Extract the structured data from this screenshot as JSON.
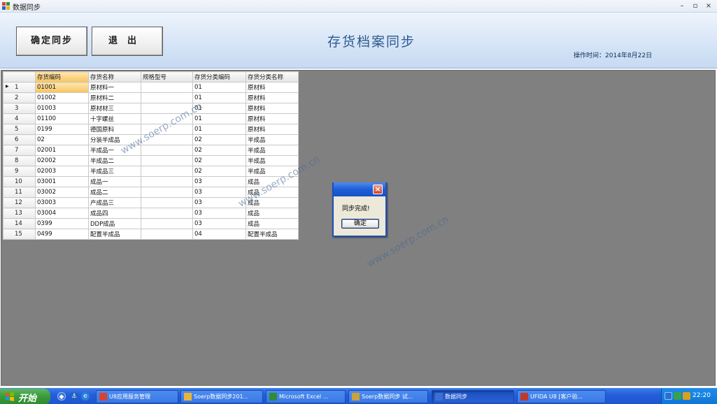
{
  "window": {
    "title": "数据同步"
  },
  "header": {
    "confirm_label": "确定同步",
    "exit_label": "退出",
    "page_title": "存货档案同步",
    "operation_time": "操作时间：2014年8月22日"
  },
  "grid": {
    "columns": [
      "存货编码",
      "存货名称",
      "规格型号",
      "存货分类编码",
      "存货分类名称"
    ],
    "rows": [
      {
        "n": "1",
        "code": "01001",
        "name": "原材料一",
        "spec": "",
        "cat_code": "01",
        "cat_name": "原材料"
      },
      {
        "n": "2",
        "code": "01002",
        "name": "原材料二",
        "spec": "",
        "cat_code": "01",
        "cat_name": "原材料"
      },
      {
        "n": "3",
        "code": "01003",
        "name": "原材材三",
        "spec": "",
        "cat_code": "01",
        "cat_name": "原材料"
      },
      {
        "n": "4",
        "code": "01100",
        "name": "十字螺丝",
        "spec": "",
        "cat_code": "01",
        "cat_name": "原材料"
      },
      {
        "n": "5",
        "code": "0199",
        "name": "德国原料",
        "spec": "",
        "cat_code": "01",
        "cat_name": "原材料"
      },
      {
        "n": "6",
        "code": "02",
        "name": "分装半成品",
        "spec": "",
        "cat_code": "02",
        "cat_name": "半成品"
      },
      {
        "n": "7",
        "code": "02001",
        "name": "半成品一",
        "spec": "",
        "cat_code": "02",
        "cat_name": "半成品"
      },
      {
        "n": "8",
        "code": "02002",
        "name": "半成品二",
        "spec": "",
        "cat_code": "02",
        "cat_name": "半成品"
      },
      {
        "n": "9",
        "code": "02003",
        "name": "半成品三",
        "spec": "",
        "cat_code": "02",
        "cat_name": "半成品"
      },
      {
        "n": "10",
        "code": "03001",
        "name": "成品一",
        "spec": "",
        "cat_code": "03",
        "cat_name": "成品"
      },
      {
        "n": "11",
        "code": "03002",
        "name": "成品二",
        "spec": "",
        "cat_code": "03",
        "cat_name": "成品"
      },
      {
        "n": "12",
        "code": "03003",
        "name": "产成品三",
        "spec": "",
        "cat_code": "03",
        "cat_name": "成品"
      },
      {
        "n": "13",
        "code": "03004",
        "name": "成品四",
        "spec": "",
        "cat_code": "03",
        "cat_name": "成品"
      },
      {
        "n": "14",
        "code": "0399",
        "name": "DDP成品",
        "spec": "",
        "cat_code": "03",
        "cat_name": "成品"
      },
      {
        "n": "15",
        "code": "0499",
        "name": "配置半成品",
        "spec": "",
        "cat_code": "04",
        "cat_name": "配置半成品"
      }
    ]
  },
  "dialog": {
    "message": "同步完成!",
    "ok_label": "确定"
  },
  "watermark": "www.soerp.com.cn",
  "taskbar": {
    "start_label": "开始",
    "tasks": [
      {
        "label": "U8应用服务管理",
        "active": false
      },
      {
        "label": "Soerp数据同步201...",
        "active": false
      },
      {
        "label": "Microsoft Excel ...",
        "active": false
      },
      {
        "label": "Soerp数据同步 试...",
        "active": false
      },
      {
        "label": "数据同步",
        "active": true
      },
      {
        "label": "UFIDA U8 [客户验...",
        "active": false
      }
    ],
    "clock": "22:20"
  }
}
